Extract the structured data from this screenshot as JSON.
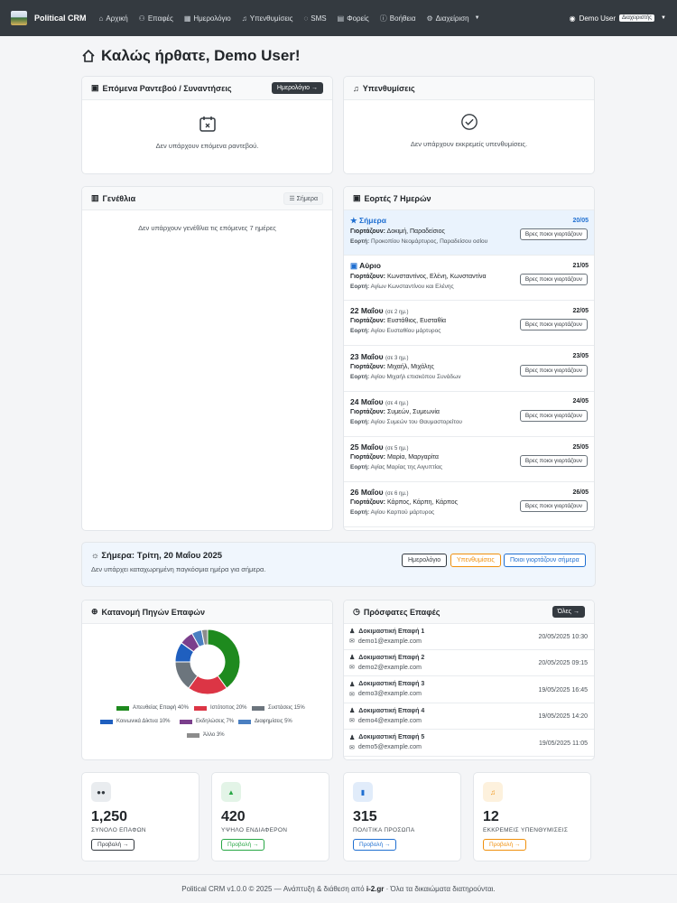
{
  "nav": {
    "brand": "Political CRM",
    "items": [
      {
        "label": "Αρχική",
        "icon": "home-icon"
      },
      {
        "label": "Επαφές",
        "icon": "users-icon"
      },
      {
        "label": "Ημερολόγιο",
        "icon": "calendar-icon"
      },
      {
        "label": "Υπενθυμίσεις",
        "icon": "bell-icon"
      },
      {
        "label": "SMS",
        "icon": "chat-icon"
      },
      {
        "label": "Φορείς",
        "icon": "building-icon"
      },
      {
        "label": "Βοήθεια",
        "icon": "help-icon"
      },
      {
        "label": "Διαχείριση",
        "icon": "gear-icon"
      }
    ],
    "user": "Demo User",
    "role_badge": "Διαχειριστής"
  },
  "page": {
    "title": "Καλώς ήρθατε, Demo User!"
  },
  "appointments": {
    "title": "Επόμενα Ραντεβού / Συναντήσεις",
    "button": "Ημερολόγιο →",
    "empty": "Δεν υπάρχουν επόμενα ραντεβού."
  },
  "reminders": {
    "title": "Υπενθυμίσεις",
    "empty": "Δεν υπάρχουν εκκρεμείς υπενθυμίσεις."
  },
  "birthdays": {
    "title": "Γενέθλια",
    "button": "Σήμερα",
    "empty": "Δεν υπάρχουν γενέθλια τις επόμενες 7 ημέρες"
  },
  "feasts": {
    "title": "Εορτές 7 Ημερών",
    "names_label": "Γιορτάζουν:",
    "feast_label": "Εορτή:",
    "button": "Βρες ποιοι γιορτάζουν",
    "items": [
      {
        "day": "Σήμερα",
        "sub": "",
        "date": "20/05",
        "names": "Δοκιμή, Παραδείσιος",
        "desc": "Προκοπίου Νεομάρτυρος, Παραδείσου οσίου"
      },
      {
        "day": "Αύριο",
        "sub": "",
        "date": "21/05",
        "names": "Κωνσταντίνος, Ελένη, Κωνσταντίνα",
        "desc": "Αγίων Κωνσταντίνου και Ελένης"
      },
      {
        "day": "22 Μαΐου",
        "sub": "(σε 2 ημ.)",
        "date": "22/05",
        "names": "Ευστάθιος, Ευσταθία",
        "desc": "Αγίου Ευσταθίου μάρτυρος"
      },
      {
        "day": "23 Μαΐου",
        "sub": "(σε 3 ημ.)",
        "date": "23/05",
        "names": "Μιχαήλ, Μιχάλης",
        "desc": "Αγίου Μιχαήλ επισκόπου Συνάδων"
      },
      {
        "day": "24 Μαΐου",
        "sub": "(σε 4 ημ.)",
        "date": "24/05",
        "names": "Συμεών, Συμεωνία",
        "desc": "Αγίου Συμεών του Θαυμαστορείτου"
      },
      {
        "day": "25 Μαΐου",
        "sub": "(σε 5 ημ.)",
        "date": "25/05",
        "names": "Μαρία, Μαργαρίτα",
        "desc": "Αγίας Μαρίας της Αιγυπτίας"
      },
      {
        "day": "26 Μαΐου",
        "sub": "(σε 6 ημ.)",
        "date": "26/05",
        "names": "Κάρπος, Κάρπη, Κάρπος",
        "desc": "Αγίου Καρπού μάρτυρος"
      }
    ]
  },
  "today": {
    "title": "Σήμερα: Τρίτη, 20 Μαΐου 2025",
    "subtitle": "Δεν υπάρχει καταχωρημένη παγκόσμια ημέρα για σήμερα.",
    "buttons": [
      "Ημερολόγιο",
      "Υπενθυμίσεις",
      "Ποιοι γιορτάζουν σήμερα"
    ]
  },
  "sources": {
    "title": "Κατανομή Πηγών Επαφών"
  },
  "chart_data": {
    "type": "pie",
    "categories": [
      "Απευθείας Επαφή",
      "Ιστότοπος",
      "Συστάσεις",
      "Κοινωνικά Δίκτυα",
      "Εκδηλώσεις",
      "Διαφημίσεις",
      "Άλλο"
    ],
    "values": [
      40,
      20,
      15,
      10,
      7,
      5,
      3
    ],
    "colors": [
      "#1e8a1e",
      "#dc3545",
      "#6c757d",
      "#1f5fbf",
      "#7b3f8c",
      "#4a7fc1",
      "#8c8c8c"
    ],
    "legend_labels": [
      "Απευθείας Επαφή 40%",
      "Ιστότοπος 20%",
      "Συστάσεις 15%",
      "Κοινωνικά Δίκτυα 10%",
      "Εκδηλώσεις 7%",
      "Διαφημίσεις 5%",
      "Άλλο 3%"
    ],
    "legend_position": "bottom"
  },
  "recent": {
    "title": "Πρόσφατες Επαφές",
    "button": "Όλες →",
    "items": [
      {
        "name": "Δοκιμαστική Επαφή 1",
        "email": "demo1@example.com",
        "date": "20/05/2025 10:30"
      },
      {
        "name": "Δοκιμαστική Επαφή 2",
        "email": "demo2@example.com",
        "date": "20/05/2025 09:15"
      },
      {
        "name": "Δοκιμαστική Επαφή 3",
        "email": "demo3@example.com",
        "date": "19/05/2025 16:45"
      },
      {
        "name": "Δοκιμαστική Επαφή 4",
        "email": "demo4@example.com",
        "date": "19/05/2025 14:20"
      },
      {
        "name": "Δοκιμαστική Επαφή 5",
        "email": "demo5@example.com",
        "date": "19/05/2025 11:05"
      }
    ]
  },
  "stats": [
    {
      "value": "1,250",
      "label": "ΣΥΝΟΛΟ ΕΠΑΦΩΝ",
      "button": "Προβολή →",
      "color": "#343a40",
      "bg": "#e9ecef",
      "icon": "users-icon"
    },
    {
      "value": "420",
      "label": "ΥΨΗΛΟ ΕΝΔΙΑΦΕΡΟΝ",
      "button": "Προβολή →",
      "color": "#28a745",
      "bg": "#e3f4e7",
      "icon": "thumbs-up-icon"
    },
    {
      "value": "315",
      "label": "ΠΟΛΙΤΙΚΑ ΠΡΟΣΩΠΑ",
      "button": "Προβολή →",
      "color": "#1f6fd1",
      "bg": "#e1ecfa",
      "icon": "bookmark-icon"
    },
    {
      "value": "12",
      "label": "ΕΚΚΡΕΜΕΙΣ ΥΠΕΝΘΥΜΙΣΕΙΣ",
      "button": "Προβολή →",
      "color": "#f0900c",
      "bg": "#fdf1dd",
      "icon": "bell-icon"
    }
  ],
  "footer": {
    "prefix": "Political CRM v1.0.0 © 2025 — Ανάπτυξη & διάθεση από",
    "brand": "i-2.gr",
    "suffix": "· Όλα τα δικαιώματα διατηρούνται."
  }
}
